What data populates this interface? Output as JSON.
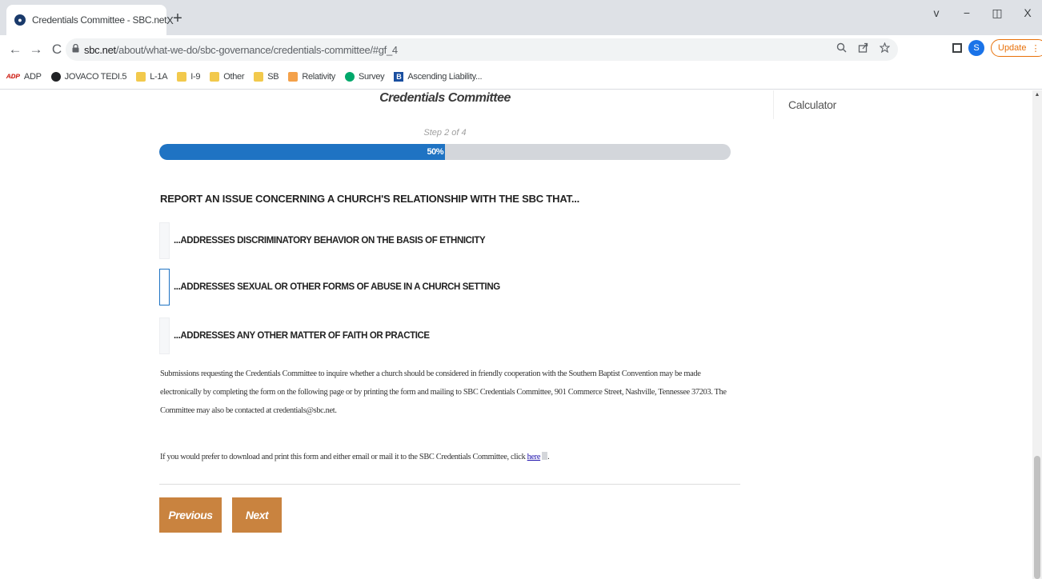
{
  "browser": {
    "tab": {
      "title": "Credentials Committee - SBC.net",
      "close": "X",
      "favicon": "sbc-logo-icon"
    },
    "new_tab": "+",
    "window_controls": {
      "menu": "v",
      "minimize": "−",
      "restore": "◫",
      "close": "X"
    },
    "nav": {
      "back": "←",
      "forward": "→",
      "reload": "C"
    },
    "url": {
      "host": "sbc.net",
      "path": "/about/what-we-do/sbc-governance/credentials-committee/#gf_4"
    },
    "update_label": "Update",
    "profile_initial": "S",
    "bookmarks": [
      {
        "label": "ADP",
        "icon": "adp-icon"
      },
      {
        "label": "JOVACO TEDI.5",
        "icon": "jovaco-icon"
      },
      {
        "label": "L-1A",
        "icon": "folder-icon"
      },
      {
        "label": "I-9",
        "icon": "folder-icon"
      },
      {
        "label": "Other",
        "icon": "folder-icon"
      },
      {
        "label": "SB",
        "icon": "folder-icon"
      },
      {
        "label": "Relativity",
        "icon": "relativity-icon"
      },
      {
        "label": "Survey",
        "icon": "survey-icon"
      },
      {
        "label": "Ascending Liability...",
        "icon": "b-icon"
      }
    ]
  },
  "form": {
    "title": "Credentials Committee",
    "step_label": "Step 2 of 4",
    "progress": {
      "percent": 50,
      "label": "50%"
    },
    "question": "REPORT AN ISSUE CONCERNING A CHURCH'S RELATIONSHIP WITH THE SBC THAT...",
    "choices": [
      "...ADDRESSES DISCRIMINATORY BEHAVIOR ON THE BASIS OF ETHNICITY",
      "...ADDRESSES SEXUAL OR OTHER FORMS OF ABUSE IN A CHURCH SETTING",
      "...ADDRESSES ANY OTHER MATTER OF FAITH OR PRACTICE"
    ],
    "description": "Submissions requesting the Credentials Committee to inquire whether a church should be considered in friendly cooperation with the Southern Baptist Convention may be made electronically by completing the form on the following page or by printing the form and mailing to SBC Credentials Committee, 901 Commerce Street, Nashville, Tennessee 37203. The Committee may also be contacted at credentials@sbc.net.",
    "download_text": "If you would prefer to download and print this form and either email or mail it to the SBC Credentials Committee, click ",
    "download_link": "here",
    "download_end": ".",
    "previous_label": "Previous",
    "next_label": "Next"
  },
  "sidebar": {
    "calculator": "Calculator"
  },
  "colors": {
    "accent": "#c9833f",
    "progress": "#1f73c3",
    "track": "#d3d6db"
  }
}
